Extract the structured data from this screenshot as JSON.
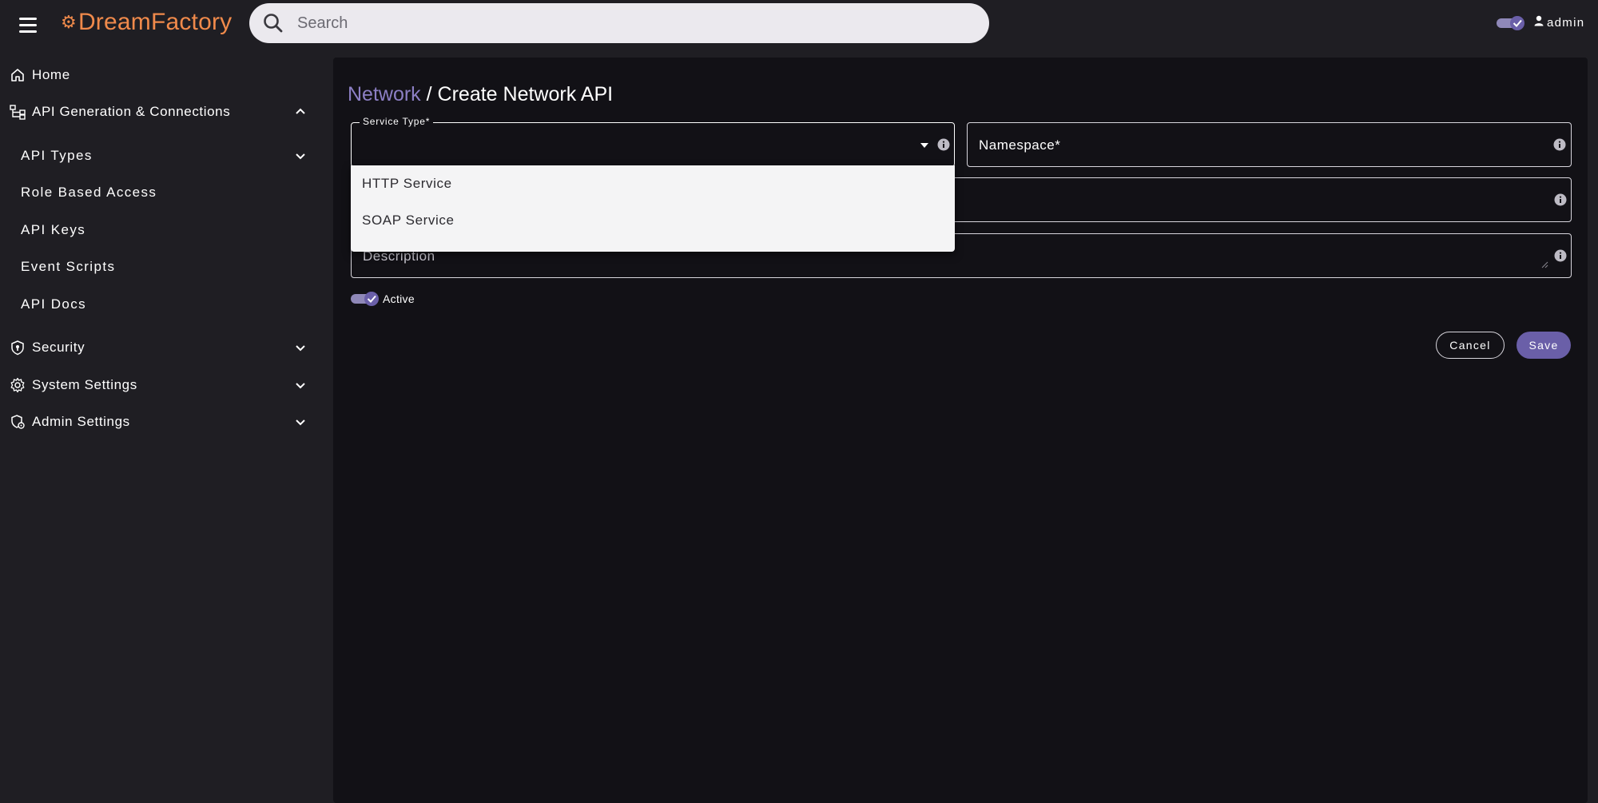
{
  "header": {
    "brand": "DreamFactory",
    "search_placeholder": "Search",
    "user_name": "admin",
    "theme_toggle_on": true
  },
  "sidebar": {
    "items": [
      {
        "label": "Home",
        "icon": "home-icon"
      },
      {
        "label": "API Generation & Connections",
        "icon": "connections-icon",
        "expanded": true
      },
      {
        "label": "API Types",
        "icon": "",
        "expanded": false
      },
      {
        "label": "Role Based Access"
      },
      {
        "label": "API Keys"
      },
      {
        "label": "Event Scripts"
      },
      {
        "label": "API Docs"
      },
      {
        "label": "Security",
        "icon": "shield-icon",
        "expanded": false
      },
      {
        "label": "System Settings",
        "icon": "gear-icon",
        "expanded": false
      },
      {
        "label": "Admin Settings",
        "icon": "admin-icon",
        "expanded": false
      }
    ]
  },
  "page": {
    "breadcrumb_link": "Network",
    "breadcrumb_sep": " / ",
    "breadcrumb_current": "Create Network API"
  },
  "form": {
    "service_type_label": "Service Type*",
    "service_type_value": "",
    "service_type_options": [
      "HTTP Service",
      "SOAP Service"
    ],
    "namespace_placeholder": "Namespace*",
    "description_placeholder": "Description",
    "active_label": "Active",
    "active_on": true,
    "cancel_label": "Cancel",
    "save_label": "Save"
  },
  "colors": {
    "accent": "#6a5fa8",
    "brand": "#f08a4b",
    "link": "#8c7fc4"
  }
}
